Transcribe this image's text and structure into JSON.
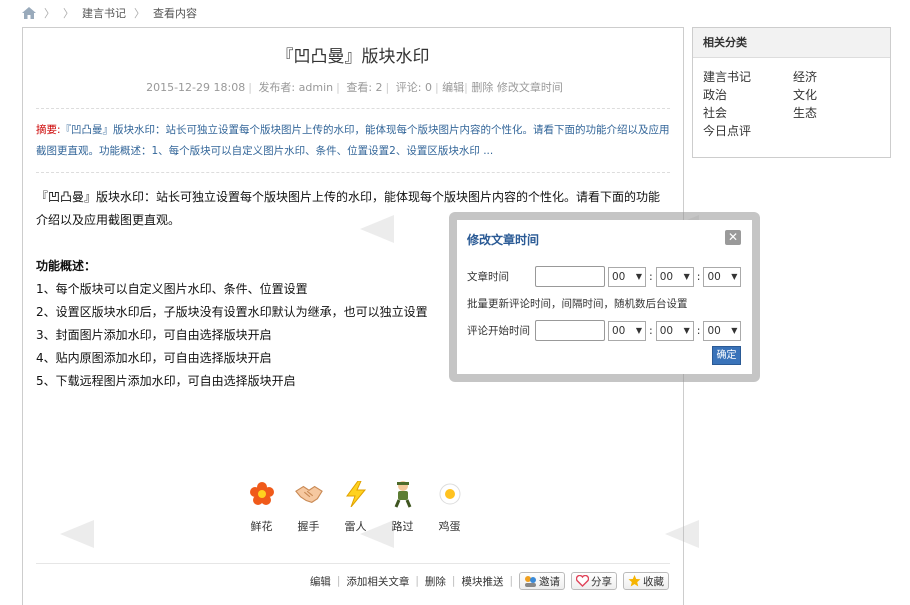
{
  "breadcrumb": {
    "items": [
      "建言书记",
      "查看内容"
    ]
  },
  "article": {
    "title": "『凹凸曼』版块水印",
    "meta": {
      "date": "2015-12-29 18:08",
      "publisher": "发布者: admin",
      "views": "查看: 2",
      "comments": "评论: 0",
      "edit": "编辑",
      "delete": "删除",
      "modify_time": "修改文章时间"
    },
    "summary_label": "摘要:",
    "summary_text": "『凹凸曼』版块水印：站长可独立设置每个版块图片上传的水印，能体现每个版块图片内容的个性化。请看下面的功能介绍以及应用截图更直观。功能概述：1、每个版块可以自定义图片水印、条件、位置设置2、设置区版块水印 ...",
    "intro": "『凹凸曼』版块水印：站长可独立设置每个版块图片上传的水印，能体现每个版块图片内容的个性化。请看下面的功能介绍以及应用截图更直观。",
    "features_heading": "功能概述：",
    "features": [
      "1、每个版块可以自定义图片水印、条件、位置设置",
      "2、设置区版块水印后，子版块没有设置水印默认为继承，也可以独立设置",
      "3、封面图片添加水印，可自由选择版块开启",
      "4、贴内原图添加水印，可自由选择版块开启",
      "5、下载远程图片添加水印，可自由选择版块开启"
    ]
  },
  "reactions": [
    {
      "icon": "flower-icon",
      "label": "鲜花"
    },
    {
      "icon": "handshake-icon",
      "label": "握手"
    },
    {
      "icon": "lightning-icon",
      "label": "雷人"
    },
    {
      "icon": "passerby-icon",
      "label": "路过"
    },
    {
      "icon": "egg-icon",
      "label": "鸡蛋"
    }
  ],
  "actions": {
    "edit": "编辑",
    "add_related": "添加相关文章",
    "delete": "删除",
    "push": "模块推送",
    "invite": "邀请",
    "share": "分享",
    "favorite": "收藏"
  },
  "sidebar": {
    "title": "相关分类",
    "categories": [
      "建言书记",
      "经济",
      "政治",
      "文化",
      "社会",
      "生态",
      "今日点评"
    ]
  },
  "dialog": {
    "title": "修改文章时间",
    "article_time_label": "文章时间",
    "hour": "00",
    "minute": "00",
    "second": "00",
    "note": "批量更新评论时间，间隔时间，随机数后台设置",
    "comment_time_label": "评论开始时间",
    "c_hour": "00",
    "c_minute": "00",
    "c_second": "00",
    "confirm": "确定",
    "close": "✕"
  }
}
